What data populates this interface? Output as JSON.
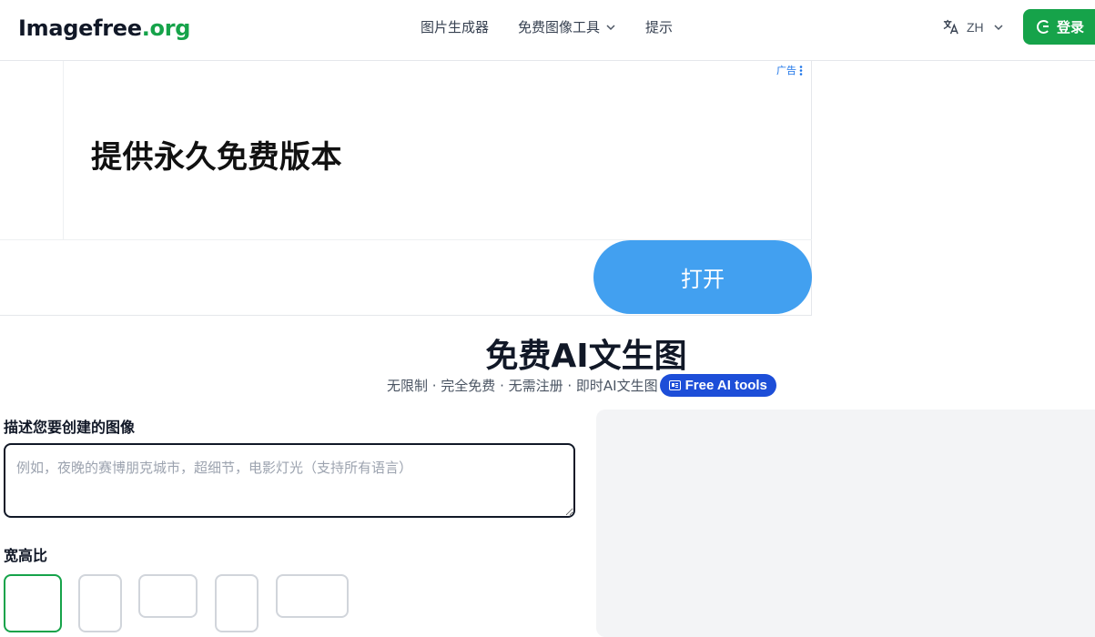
{
  "header": {
    "logo_main": "Imagefree",
    "logo_tld": ".org",
    "nav": [
      {
        "label": "图片生成器"
      },
      {
        "label": "免费图像工具"
      },
      {
        "label": "提示"
      }
    ],
    "language": "ZH",
    "login_label": "登录"
  },
  "ad": {
    "label": "广告",
    "headline": "提供永久免费版本",
    "open_button": "打开"
  },
  "hero": {
    "title": "免费AI文生图",
    "subtitle": "无限制 · 完全免费 · 无需注册 · 即时AI文生图",
    "badge": "Free AI tools"
  },
  "form": {
    "prompt_label": "描述您要创建的图像",
    "prompt_placeholder": "例如，夜晚的赛博朋克城市，超细节，电影灯光（支持所有语言）",
    "prompt_value": "",
    "aspect_label": "宽高比"
  },
  "colors": {
    "brand_green": "#16a34a",
    "ad_button_blue": "#42a0f0",
    "badge_blue": "#1d4ed8"
  },
  "icons": [
    "translate-icon",
    "chevron-down-icon",
    "google-icon",
    "ad-menu-icon",
    "tools-icon"
  ]
}
